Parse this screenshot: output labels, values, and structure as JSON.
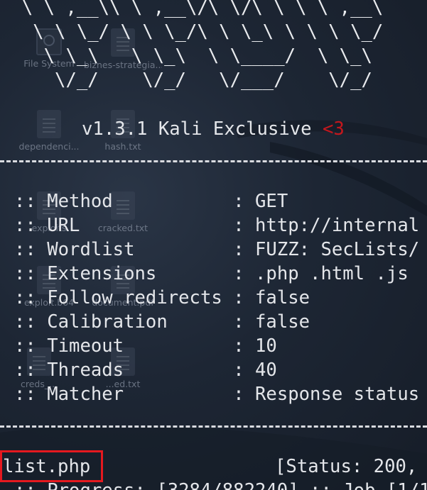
{
  "desktop_icons": [
    {
      "label": "File System",
      "type": "drive"
    },
    {
      "label": "biznes-strategia...",
      "type": "doc"
    },
    {
      "label": "dependenci...",
      "type": "script"
    },
    {
      "label": "hash.txt",
      "type": "doc"
    },
    {
      "label": "exploits",
      "type": "doc"
    },
    {
      "label": "cracked.txt",
      "type": "doc"
    },
    {
      "label": "exploit.b64",
      "type": "doc"
    },
    {
      "label": "document.pdf",
      "type": "doc"
    },
    {
      "label": "creds_...",
      "type": "doc"
    },
    {
      "label": "...ed.txt",
      "type": "doc"
    }
  ],
  "terminal": {
    "ascii_banner": [
      "  \\ \\ ,__\\\\ \\ ,__\\/\\ \\/\\ \\ \\ \\ ,__\\",
      "   \\ \\ \\_/ \\ \\ \\_/\\ \\ \\_\\ \\ \\ \\ \\_/",
      "    \\ \\_\\   \\ \\_\\  \\ \\____/  \\ \\_\\",
      "     \\/_/    \\/_/   \\/___/    \\/_/"
    ],
    "version": "v1.3.1 Kali Exclusive",
    "heart": "<3",
    "separator": "________________________________________________",
    "config": [
      {
        "key": ":: Method           ",
        "value": ": GET"
      },
      {
        "key": ":: URL              ",
        "value": ": http://internal"
      },
      {
        "key": ":: Wordlist         ",
        "value": ": FUZZ: SecLists/"
      },
      {
        "key": ":: Extensions       ",
        "value": ": .php .html .js"
      },
      {
        "key": ":: Follow redirects ",
        "value": ": false"
      },
      {
        "key": ":: Calibration      ",
        "value": ": false"
      },
      {
        "key": ":: Timeout          ",
        "value": ": 10"
      },
      {
        "key": ":: Threads          ",
        "value": ": 40"
      },
      {
        "key": ":: Matcher          ",
        "value": ": Response status"
      }
    ],
    "result_name": "list.php",
    "result_status": "[Status: 200,",
    "progress": ":: Progress: [3284/882240] :: Job [1/1"
  },
  "colors": {
    "heart": "#c4171d",
    "highlight": "#e5191f",
    "text": "#e4e6ea"
  }
}
